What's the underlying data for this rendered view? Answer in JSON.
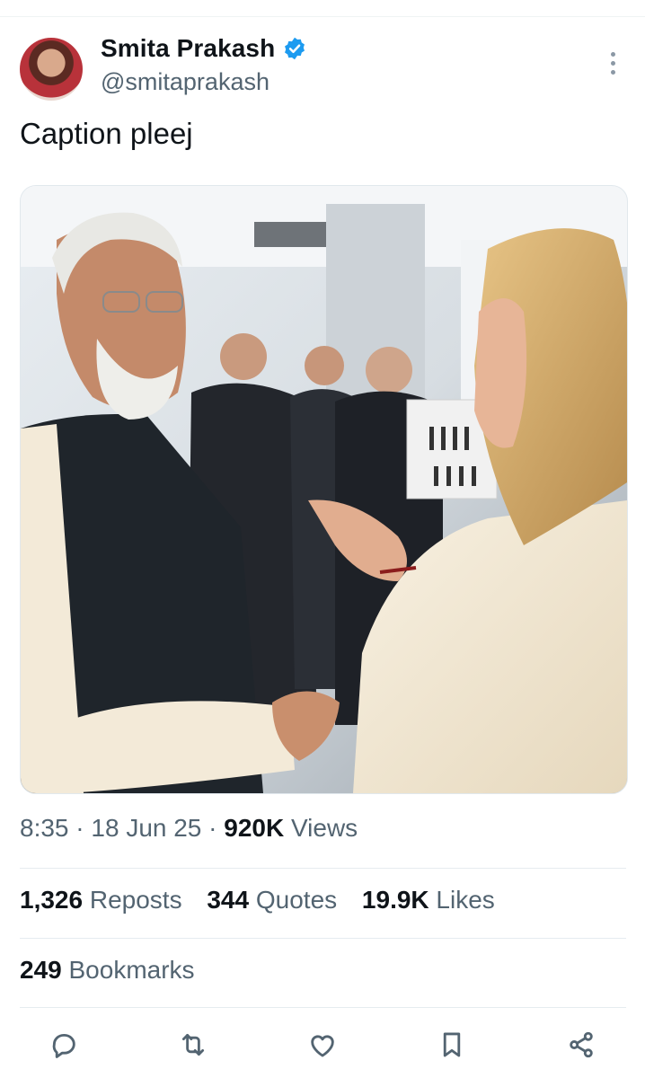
{
  "post": {
    "author_name": "Smita Prakash",
    "handle": "@smitaprakash",
    "text": "Caption pleej",
    "time": "8:35",
    "date": "18 Jun 25",
    "views_count": "920K",
    "views_label": "Views",
    "separator": "·"
  },
  "stats": {
    "reposts_count": "1,326",
    "reposts_label": "Reposts",
    "quotes_count": "344",
    "quotes_label": "Quotes",
    "likes_count": "19.9K",
    "likes_label": "Likes",
    "bookmarks_count": "249",
    "bookmarks_label": "Bookmarks"
  },
  "icons": {
    "verified": "verified-badge-icon",
    "more": "more-options-icon",
    "reply": "reply-icon",
    "repost": "repost-icon",
    "like": "heart-icon",
    "bookmark": "bookmark-icon",
    "share": "share-icon"
  },
  "colors": {
    "verified_blue": "#1d9bf0",
    "secondary_text": "#536471",
    "primary_text": "#0f1419"
  }
}
